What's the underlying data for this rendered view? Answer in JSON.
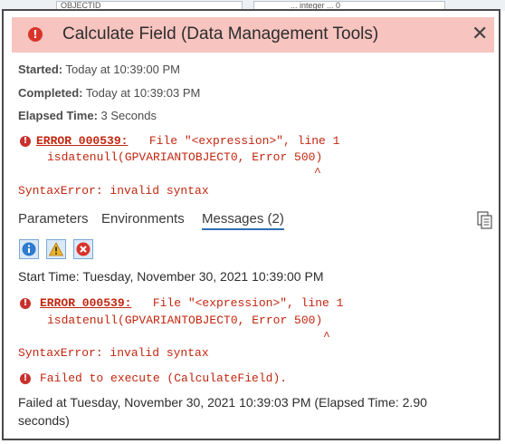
{
  "background": {
    "col1": "OBJECTID",
    "col2": "... integer ... 0"
  },
  "dialog": {
    "title": "Calculate Field (Data Management Tools)",
    "close_icon": "close-icon",
    "error_icon": "error-icon"
  },
  "summary": {
    "started_label": "Started:",
    "started_value": "Today at 10:39:00 PM",
    "completed_label": "Completed:",
    "completed_value": "Today at 10:39:03 PM",
    "elapsed_label": "Elapsed Time:",
    "elapsed_value": "3 Seconds"
  },
  "error_block": {
    "code": "ERROR 000539:",
    "line1_rest": "   File \"<expression>\", line 1",
    "line2": "isdatenull(GPVARIANTOBJECT0, Error 500)",
    "caret": "^",
    "syntax": "SyntaxError: invalid syntax"
  },
  "tabs": [
    {
      "label": "Parameters",
      "active": false
    },
    {
      "label": "Environments",
      "active": false
    },
    {
      "label": "Messages (2)",
      "active": true
    }
  ],
  "filters": [
    {
      "name": "info-filter",
      "icon": "info-icon"
    },
    {
      "name": "warning-filter",
      "icon": "warning-icon"
    },
    {
      "name": "error-filter",
      "icon": "error-icon"
    }
  ],
  "messages": {
    "start_time": "Start Time: Tuesday, November 30, 2021 10:39:00 PM",
    "error_code": "ERROR 000539:",
    "error_line1_rest": "   File \"<expression>\", line 1",
    "error_line2": "isdatenull(GPVARIANTOBJECT0, Error 500)",
    "caret": "^",
    "syntax": "SyntaxError: invalid syntax",
    "failed_execute": "Failed to execute (CalculateField).",
    "failed_at_line1": "Failed at Tuesday, November 30, 2021 10:39:03 PM (Elapsed Time: 2.90",
    "failed_at_line2": "seconds)"
  },
  "colors": {
    "title_bg": "#f7c4bf",
    "error_red": "#c2260f",
    "tab_underline": "#2f6fb3"
  }
}
